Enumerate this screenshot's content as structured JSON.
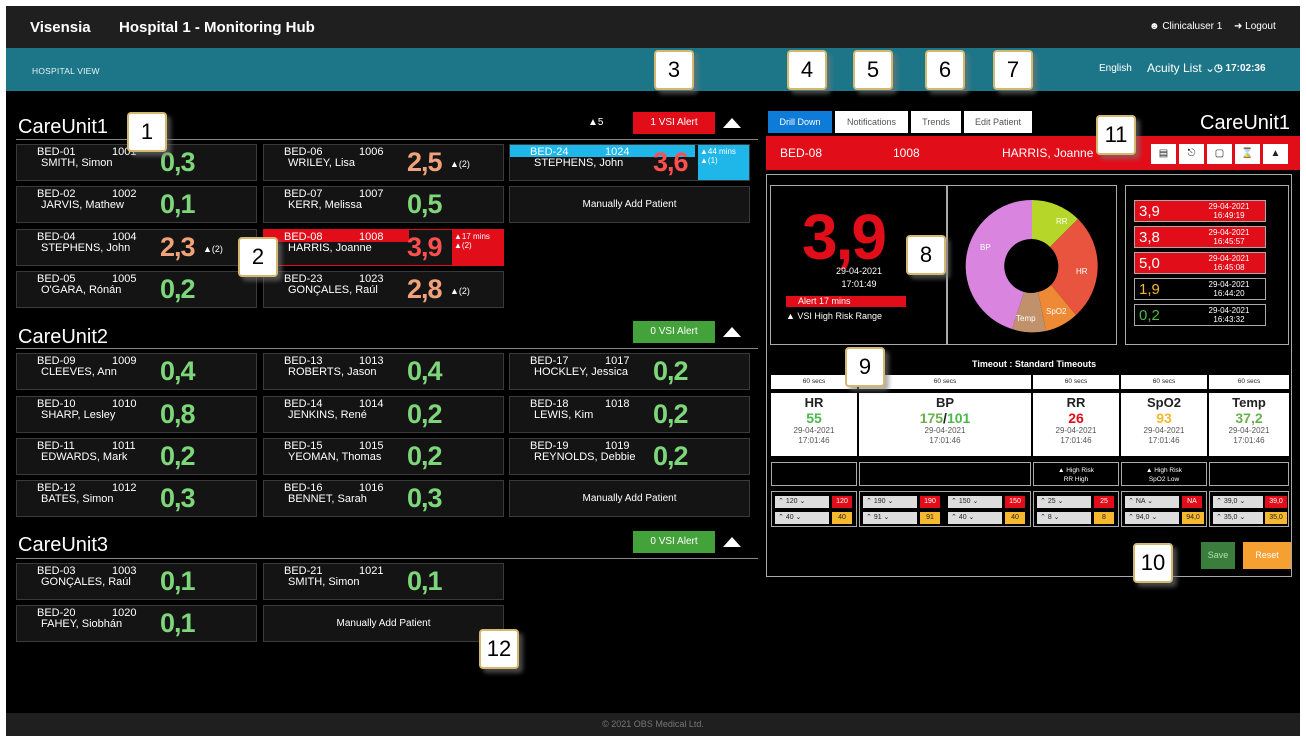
{
  "header": {
    "brand": "Visensia",
    "title": "Hospital 1 - Monitoring Hub",
    "user": "Clinicaluser 1",
    "logout": "Logout"
  },
  "subbar": {
    "view": "HOSPITAL VIEW",
    "language": "English",
    "list": "Acuity List",
    "time": "17:02:36"
  },
  "units": [
    {
      "name": "CareUnit1",
      "warn_count": "5",
      "alert": "1 VSI Alert"
    },
    {
      "name": "CareUnit2",
      "alert": "0 VSI Alert"
    },
    {
      "name": "CareUnit3",
      "alert": "0 VSI Alert"
    }
  ],
  "cards": [
    {
      "bed": "BED-01",
      "num": "1001",
      "name": "SMITH, Simon",
      "score": "0,3"
    },
    {
      "bed": "BED-02",
      "num": "1002",
      "name": "JARVIS, Mathew",
      "score": "0,1"
    },
    {
      "bed": "BED-04",
      "num": "1004",
      "name": "STEPHENS, John",
      "score": "2,3",
      "warn": "(2)"
    },
    {
      "bed": "BED-05",
      "num": "1005",
      "name": "O'GARA, Rónán",
      "score": "0,2"
    },
    {
      "bed": "BED-06",
      "num": "1006",
      "name": "WRILEY, Lisa",
      "score": "2,5",
      "warn": "(2)"
    },
    {
      "bed": "BED-07",
      "num": "1007",
      "name": "KERR, Melissa",
      "score": "0,5"
    },
    {
      "bed": "BED-08",
      "num": "1008",
      "name": "HARRIS, Joanne",
      "score": "3,9",
      "alert": "17 mins",
      "warn": "(2)"
    },
    {
      "bed": "BED-23",
      "num": "1023",
      "name": "GONÇALES, Raúl",
      "score": "2,8",
      "warn": "(2)"
    },
    {
      "bed": "BED-24",
      "num": "1024",
      "name": "STEPHENS, John",
      "score": "3,6",
      "alert": "44 mins",
      "warn": "(1)"
    },
    {
      "bed": "BED-09",
      "num": "1009",
      "name": "CLEEVES, Ann",
      "score": "0,4"
    },
    {
      "bed": "BED-10",
      "num": "1010",
      "name": "SHARP, Lesley",
      "score": "0,8"
    },
    {
      "bed": "BED-11",
      "num": "1011",
      "name": "EDWARDS, Mark",
      "score": "0,2"
    },
    {
      "bed": "BED-12",
      "num": "1012",
      "name": "BATES, Simon",
      "score": "0,3"
    },
    {
      "bed": "BED-13",
      "num": "1013",
      "name": "ROBERTS, Jason",
      "score": "0,4"
    },
    {
      "bed": "BED-14",
      "num": "1014",
      "name": "JENKINS, René",
      "score": "0,2"
    },
    {
      "bed": "BED-15",
      "num": "1015",
      "name": "YEOMAN, Thomas",
      "score": "0,2"
    },
    {
      "bed": "BED-16",
      "num": "1016",
      "name": "BENNET, Sarah",
      "score": "0,3"
    },
    {
      "bed": "BED-17",
      "num": "1017",
      "name": "HOCKLEY, Jessica",
      "score": "0,2"
    },
    {
      "bed": "BED-18",
      "num": "1018",
      "name": "LEWIS, Kim",
      "score": "0,2"
    },
    {
      "bed": "BED-19",
      "num": "1019",
      "name": "REYNOLDS, Debbie",
      "score": "0,2"
    },
    {
      "bed": "BED-03",
      "num": "1003",
      "name": "GONÇALES, Raúl",
      "score": "0,1"
    },
    {
      "bed": "BED-20",
      "num": "1020",
      "name": "FAHEY, Siobhán",
      "score": "0,1"
    },
    {
      "bed": "BED-21",
      "num": "1021",
      "name": "SMITH, Simon",
      "score": "0,1"
    }
  ],
  "manual_add": "Manually Add Patient",
  "tabs": [
    "Drill Down",
    "Notifications",
    "Trends",
    "Edit Patient"
  ],
  "right_unit": "CareUnit1",
  "patient": {
    "bed": "BED-08",
    "num": "1008",
    "name": "HARRIS, Joanne",
    "score": "3,9",
    "date": "29-04-2021",
    "time": "17:01:49",
    "alert": "Alert 17 mins",
    "risk": "VSI High Risk Range"
  },
  "donut_labels": [
    "RR",
    "HR",
    "SpO2",
    "Temp",
    "BP"
  ],
  "history": [
    {
      "v": "3,9",
      "date": "29-04-2021",
      "time": "16:49:19"
    },
    {
      "v": "3,8",
      "date": "29-04-2021",
      "time": "16:45:57"
    },
    {
      "v": "5,0",
      "date": "29-04-2021",
      "time": "16:45:08"
    },
    {
      "v": "1,9",
      "date": "29-04-2021",
      "time": "16:44:20"
    },
    {
      "v": "0,2",
      "date": "29-04-2021",
      "time": "16:43:32"
    }
  ],
  "timeout": "Timeout : Standard Timeouts",
  "timeouts": [
    "60 secs",
    "60 secs",
    "60 secs",
    "60 secs",
    "60 secs"
  ],
  "vitals": [
    {
      "title": "HR",
      "value": "55",
      "date": "29-04-2021",
      "time": "17:01:46"
    },
    {
      "title": "BP",
      "value": "175",
      "value2": "101",
      "date": "29-04-2021",
      "time": "17:01:46"
    },
    {
      "title": "RR",
      "value": "26",
      "date": "29-04-2021",
      "time": "17:01:46"
    },
    {
      "title": "SpO2",
      "value": "93",
      "date": "29-04-2021",
      "time": "17:01:46"
    },
    {
      "title": "Temp",
      "value": "37,2",
      "date": "29-04-2021",
      "time": "17:01:46"
    }
  ],
  "warnings": [
    {
      "a": "High Risk",
      "b": "RR High"
    },
    {
      "a": "High Risk",
      "b": "SpO2 Low"
    }
  ],
  "thresholds": {
    "hr": [
      "120",
      "120",
      "40",
      "40"
    ],
    "bp": [
      "190",
      "190",
      "150",
      "150",
      "91",
      "91",
      "40",
      "40"
    ],
    "rr": [
      "25",
      "25",
      "8",
      "8"
    ],
    "spo2": [
      "NA",
      "NA",
      "94,0",
      "94,0"
    ],
    "temp": [
      "39,0",
      "39,0",
      "35,0",
      "35,0"
    ]
  },
  "buttons": {
    "save": "Save",
    "reset": "Reset"
  },
  "footer": "© 2021 OBS Medical Ltd.",
  "callouts": [
    "1",
    "2",
    "3",
    "4",
    "5",
    "6",
    "7",
    "8",
    "9",
    "10",
    "11",
    "12"
  ]
}
